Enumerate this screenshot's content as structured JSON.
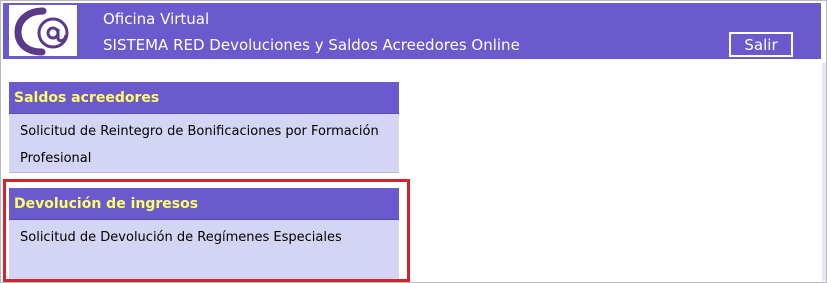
{
  "header": {
    "title": "Oficina Virtual",
    "subtitle": "SISTEMA RED Devoluciones y Saldos Acreedores Online",
    "logout_label": "Salir",
    "logo_icon": "at-sign-logo-icon"
  },
  "sections": [
    {
      "heading": "Saldos acreedores",
      "link_label": "Solicitud de Reintegro de Bonificaciones por Formación Profesional",
      "highlighted": false
    },
    {
      "heading": "Devolución de ingresos",
      "link_label": "Solicitud de Devolución de Regímenes Especiales",
      "highlighted": true
    }
  ],
  "colors": {
    "header_bg": "#6a5acd",
    "section_heading_text": "#ffff66",
    "section_body_bg": "#d4d4f4",
    "highlight_border": "#d4242b"
  }
}
